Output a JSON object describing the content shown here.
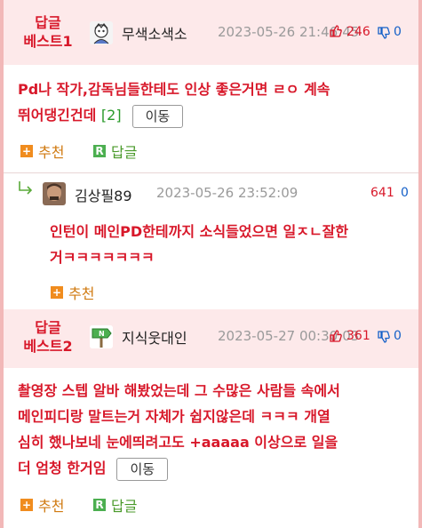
{
  "posts": [
    {
      "best_label_line1": "답글",
      "best_label_line2": "베스트1",
      "nickname": "무색소색소",
      "datetime": "2023-05-26 21:46:45",
      "up": "246",
      "down": "0",
      "content_line1": "Pd나 작가,감독님들한테도 인상 좋은거면 ㄹㅇ 계속",
      "content_line2": "뛰어댕긴건데",
      "reply_count": "[2]",
      "move_label": "이동",
      "recommend_label": "추천",
      "reply_label": "답글"
    },
    {
      "nickname": "김상필89",
      "datetime": "2023-05-26 23:52:09",
      "up": "641",
      "down": "0",
      "content_line1": "인턴이 메인PD한테까지 소식들었으면 일ㅈㄴ잘한",
      "content_line2": "거ㅋㅋㅋㅋㅋㅋㅋ",
      "recommend_label": "추천"
    },
    {
      "best_label_line1": "답글",
      "best_label_line2": "베스트2",
      "nickname": "지식웃대인",
      "datetime": "2023-05-27 00:30:03",
      "up": "361",
      "down": "0",
      "content_line1": "촬영장 스텝 알바 해봤었는데 그 수많은 사람들 속에서",
      "content_line2": "메인피디랑 말트는거 자체가 쉽지않은데 ㅋㅋㅋ 개열",
      "content_line3": "심히 했나보네 눈에띄려고도 +aaaaa 이상으로 일을",
      "content_line4": "더 엄청 한거임",
      "move_label": "이동",
      "recommend_label": "추천",
      "reply_label": "답글"
    }
  ],
  "icons": {
    "reply_arrow": "reply-arrow-icon",
    "thumb_up": "thumbs-up-icon",
    "thumb_down": "thumbs-down-icon",
    "recommend": "plus-square-icon",
    "reply": "r-square-icon"
  },
  "colors": {
    "best_red": "#d8182a",
    "header_bg": "#fde9ea",
    "border_pink": "#f2b8b8",
    "reply_green": "#4a9a2a",
    "recommend_orange": "#d07a10",
    "down_blue": "#1560c8"
  }
}
